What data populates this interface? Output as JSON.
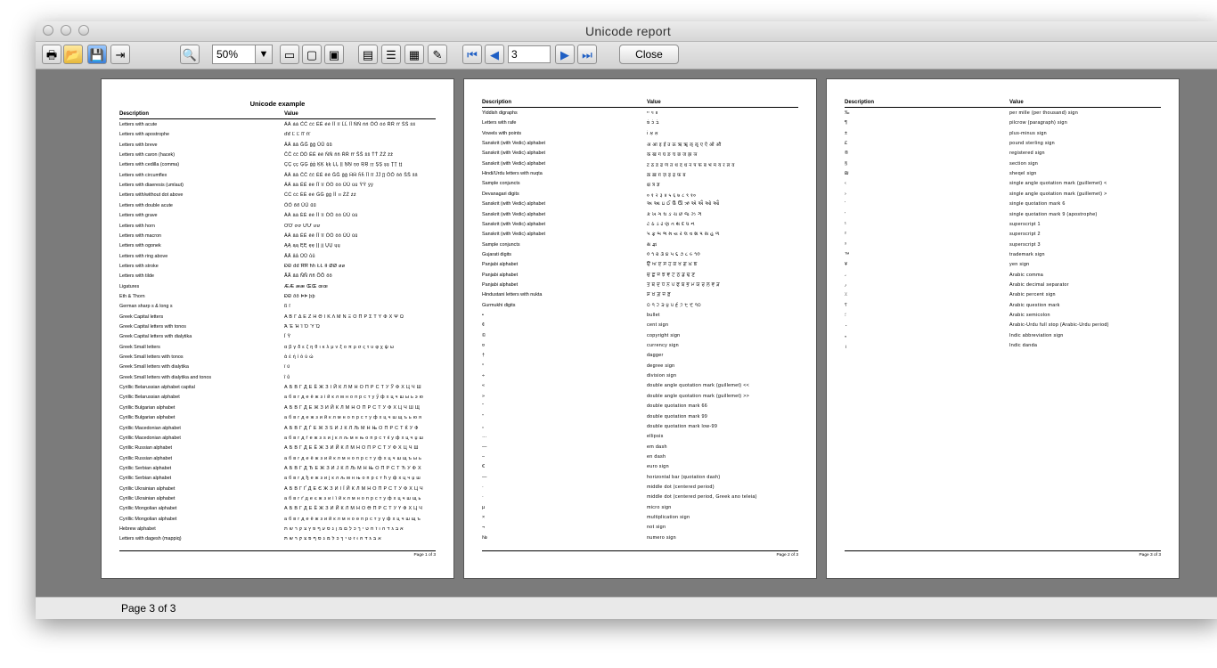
{
  "window": {
    "title": "Unicode report"
  },
  "toolbar": {
    "zoom_value": "50%",
    "page_value": "3",
    "close_label": "Close",
    "icons": [
      "print-icon",
      "open-folder-icon",
      "save-icon",
      "export-icon",
      "find-icon",
      "fit-page-icon",
      "single-page-icon",
      "two-page-icon",
      "page-layout-icon",
      "continuous-icon",
      "thumbnail-icon",
      "edit-icon",
      "first-page-icon",
      "previous-page-icon",
      "next-page-icon",
      "last-page-icon"
    ]
  },
  "status": {
    "text": "Page 3 of 3"
  },
  "pages": [
    {
      "title": "Unicode example",
      "col_desc": "Description",
      "col_value": "Value",
      "footer": "Page 1 of 3",
      "rows": [
        {
          "d": "Letters with acute",
          "v": "ÁÁ áá ĆĆ ćć ÉÉ éé ÍÍ íí ĹĹ ĺĺ ŃŃ ńń ÓÓ óó ŔŔ ŕŕ ŚŚ śś"
        },
        {
          "d": "Letters with apostrophe",
          "v": "ďď Ľ Ľ ľľ ťť"
        },
        {
          "d": "Letters with breve",
          "v": "ĂĂ ăă ĞĞ ğğ ŬŬ ŭŭ"
        },
        {
          "d": "Letters with caron (hacek)",
          "v": "ČČ čč ĎĎ ĚĚ ěě ŇŇ ňň ŘŘ řř ŠŠ šš ŤŤ ŽŽ žž"
        },
        {
          "d": "Letters with cedilla (comma)",
          "v": "ÇÇ çç ĢĢ ģģ ĶĶ ķķ ĻĻ ļļ ŅŅ ņņ ŖŖ ŗŗ ŞŞ şş ŢŢ ţţ"
        },
        {
          "d": "Letters with circumflex",
          "v": "ÂÂ ââ ĈĈ ĉĉ ÊÊ êê ĜĜ ĝĝ ĤĤ ĥĥ ÎÎ îî ĴĴ ĵĵ ÔÔ ôô ŜŜ ŝŝ"
        },
        {
          "d": "Letters with diaeresis (umlaut)",
          "v": "ÄÄ ää ËË ëë ÏÏ ïï ÖÖ öö ÜÜ üü ŸŸ ÿÿ"
        },
        {
          "d": "Letters with/without dot above",
          "v": "ĊĊ ċċ ĖĖ ėė ĠĠ ġġ İİ ıı ŻŻ żż"
        },
        {
          "d": "Letters with double acute",
          "v": "ŐŐ őő ŰŰ űű"
        },
        {
          "d": "Letters with grave",
          "v": "ÀÀ àà ÈÈ èè ÌÌ ìì ÒÒ òò ÙÙ ùù"
        },
        {
          "d": "Letters with horn",
          "v": "ƠƠ ơơ ƯƯ ưư"
        },
        {
          "d": "Letters with macron",
          "v": "ĀĀ āā ĒĒ ēē ĪĪ īī ŌŌ ōō ŪŪ ūū"
        },
        {
          "d": "Letters with ogonek",
          "v": "ĄĄ ąą ĘĘ ęę ĮĮ įį ŲŲ ųų"
        },
        {
          "d": "Letters with ring above",
          "v": "ÅÅ åå ŮŮ ůů"
        },
        {
          "d": "Letters with stroke",
          "v": "ĐĐ đđ ĦĦ ħħ ŁŁ łł ØØ øø"
        },
        {
          "d": "Letters with tilde",
          "v": "ÃÃ ãã ÑÑ ññ ÕÕ õõ"
        },
        {
          "d": "Ligatures",
          "v": "ÆÆ ææ ŒŒ œœ"
        },
        {
          "d": "Eth & Thorn",
          "v": "ÐÐ ðð ÞÞ þþ"
        },
        {
          "d": "German sharp s & long s",
          "v": "ß ſ"
        },
        {
          "d": "Greek Capital letters",
          "v": "Α Β Γ Δ Ε Ζ Η Θ Ι Κ Λ Μ Ν Ξ Ο Π Ρ Σ Τ Υ Φ Χ Ψ Ω"
        },
        {
          "d": "Greek Capital letters with tonos",
          "v": "Ά Έ Ή Ί Ό Ύ Ώ"
        },
        {
          "d": "Greek Capital letters with dialytika",
          "v": "Ϊ Ϋ"
        },
        {
          "d": "Greek Small letters",
          "v": "α β γ δ ε ζ η θ ι κ λ μ ν ξ ο π ρ σ ς τ υ φ χ ψ ω"
        },
        {
          "d": "Greek Small letters with tonos",
          "v": "ά έ ή ί ό ύ ώ"
        },
        {
          "d": "Greek Small letters with dialytika",
          "v": "ϊ ϋ"
        },
        {
          "d": "Greek Small letters with dialytika and tonos",
          "v": "ΐ ΰ"
        },
        {
          "d": "Cyrillic Belarussian alphabet capital",
          "v": "А Б В Г Д Е Ё Ж З І Й К Л М Н О П Р С Т У Ў Ф Х Ц Ч Ш"
        },
        {
          "d": "Cyrillic Belarussian alphabet",
          "v": "а б в г д е ё ж з і й к л м н о п р с т у ў ф х ц ч ш ы ь э ю"
        },
        {
          "d": "Cyrillic Bulgarian alphabet",
          "v": "А Б В Г Д Е Ж З И Й К Л М Н О П Р С Т У Ф Х Ц Ч Ш Щ"
        },
        {
          "d": "Cyrillic Bulgarian alphabet",
          "v": "а б в г д е ж з и й к л м н о п р с т у ф х ц ч ш щ ъ ь ю я"
        },
        {
          "d": "Cyrillic Macedonian alphabet",
          "v": "А Б В Г Д Ѓ Е Ж З Ѕ И Ј К Л Љ М Н Њ О П Р С Т Ќ У Ф"
        },
        {
          "d": "Cyrillic Macedonian alphabet",
          "v": "а б в г д ѓ е ж з ѕ и ј к л љ м н њ о п р с т ќ у ф х ц ч џ ш"
        },
        {
          "d": "Cyrillic Russian alphabet",
          "v": "А Б В Г Д Е Ё Ж З И Й К Л М Н О П Р С Т У Ф Х Ц Ч Ш"
        },
        {
          "d": "Cyrillic Russian alphabet",
          "v": "а б в г д е ё ж з и й к л м н о п р с т у ф х ц ч ш щ ъ ы ь"
        },
        {
          "d": "Cyrillic Serbian alphabet",
          "v": "А Б В Г Д Ђ Е Ж З И Ј К Л Љ М Н Њ О П Р С Т Ћ У Ф Х"
        },
        {
          "d": "Cyrillic Serbian alphabet",
          "v": "а б в г д ђ е ж з и ј к л љ м н њ о п р с т ћ у ф х ц ч џ ш"
        },
        {
          "d": "Cyrillic Ukrainian alphabet",
          "v": "А Б В Г Ґ Д Е Є Ж З И І Ї Й К Л М Н О П Р С Т У Ф Х Ц Ч"
        },
        {
          "d": "Cyrillic Ukrainian alphabet",
          "v": "а б в г ґ д е є ж з и і ї й к л м н о п р с т у ф х ц ч ш щ ь"
        },
        {
          "d": "Cyrillic Mongolian alphabet",
          "v": "А Б В Г Д Е Ё Ж З И Й К Л М Н О Ө П Р С Т У Ү Ф Х Ц Ч"
        },
        {
          "d": "Cyrillic Mongolian alphabet",
          "v": "а б в г д е ё ж з и й к л м н о ө п р с т у ү ф х ц ч ш щ ъ"
        },
        {
          "d": "Hebrew alphabet",
          "v": "א ב ג ד ה ו ז ח ט י ך כ ל ם מ ן נ ס ע ף פ ץ צ ק ר ש ת"
        },
        {
          "d": "Letters with dagesh (mappiq)",
          "v": "אּ בּ גּ דּ הּ וּ זּ טּ יּ ךּ כּ לּ מּ נּ סּ ףּ פּ צּ קּ רּ שּ תּ"
        }
      ]
    },
    {
      "col_desc": "Description",
      "col_value": "Value",
      "footer": "Page 2 of 3",
      "rows": [
        {
          "d": "Yiddish digraphs",
          "v": "װ ױ ײ"
        },
        {
          "d": "Letters with rafe",
          "v": "בֿ כֿ פֿ"
        },
        {
          "d": "Vowels with points",
          "v": "אַ אָ וֹ"
        },
        {
          "d": "Sanskrit (with Vedic) alphabet",
          "v": "अ आ इ ई उ ऊ ऋ ॠ ऌ ॡ ए ऐ ओ औ"
        },
        {
          "d": "Sanskrit (with Vedic) alphabet",
          "v": "क ख ग घ ङ च छ ज झ ञ"
        },
        {
          "d": "Sanskrit (with Vedic) alphabet",
          "v": "ट ठ ड ढ ण त थ द ध न प फ ब भ म य र ल व"
        },
        {
          "d": "Hindi/Urdu letters with nuqta",
          "v": "क़ ख़ ग़ ज़ ड़ ढ़ फ़ य़"
        },
        {
          "d": "Sample conjuncts",
          "v": "क्ष त्र ज्ञ"
        },
        {
          "d": "Devanagari digits",
          "v": "० १ २ ३ ४ ५ ६ ७ ८ ९ १०"
        },
        {
          "d": "Sanskrit (with Vedic) alphabet",
          "v": "અ આ ઇ ઈ ઉ ઊ ઋ એ ઐ ઓ ઔ"
        },
        {
          "d": "Sanskrit (with Vedic) alphabet",
          "v": "ક ખ ગ ઘ ઙ ચ છ જ ઝ ઞ"
        },
        {
          "d": "Sanskrit (with Vedic) alphabet",
          "v": "ટ ઠ ડ ઢ ણ ત થ દ ધ ન"
        },
        {
          "d": "Sanskrit (with Vedic) alphabet",
          "v": "પ ફ બ ભ મ ય ર લ વ શ ષ સ હ ળ"
        },
        {
          "d": "Sample conjuncts",
          "v": "ક્ષ જ્ઞ"
        },
        {
          "d": "Gujarati digits",
          "v": "૦ ૧ ૨ ૩ ૪ ૫ ૬ ૭ ૮ ૯ ૧૦"
        },
        {
          "d": "Panjabi alphabet",
          "v": "ੳ ਅ ੲ ਸ ਹ ਕ ਖ ਗ ਘ ਙ"
        },
        {
          "d": "Panjabi alphabet",
          "v": "ਚ ਛ ਜ ਝ ਞ ਟ ਠ ਡ ਢ ਣ"
        },
        {
          "d": "Panjabi alphabet",
          "v": "ਤ ਥ ਦ ਧ ਨ ਪ ਫ ਬ ਭ ਮ ਯ ਰ ਲ ਵ ੜ"
        },
        {
          "d": "Hindustani letters with nukta",
          "v": "ਸ਼ ਖ਼ ਗ਼ ਜ਼ ਫ਼"
        },
        {
          "d": "Gurmukhi digits",
          "v": "੦ ੧ ੨ ੩ ੪ ੫ ੬ ੭ ੮ ੯ ੧੦"
        },
        {
          "d": "•",
          "v": "bullet"
        },
        {
          "d": "¢",
          "v": "cent sign"
        },
        {
          "d": "©",
          "v": "copyright sign"
        },
        {
          "d": "¤",
          "v": "currency sign"
        },
        {
          "d": "†",
          "v": "dagger"
        },
        {
          "d": "°",
          "v": "degree sign"
        },
        {
          "d": "÷",
          "v": "division sign"
        },
        {
          "d": "«",
          "v": "double angle quotation mark (guillemet) <<"
        },
        {
          "d": "»",
          "v": "double angle quotation mark (guillemet) >>"
        },
        {
          "d": "“",
          "v": "double quotation mark 66"
        },
        {
          "d": "”",
          "v": "double quotation mark 99"
        },
        {
          "d": "„",
          "v": "double quotation mark low-99"
        },
        {
          "d": "…",
          "v": "ellipsis"
        },
        {
          "d": "—",
          "v": "em dash"
        },
        {
          "d": "–",
          "v": "en dash"
        },
        {
          "d": "€",
          "v": "euro sign"
        },
        {
          "d": "―",
          "v": "horizontal bar (quotation dash)"
        },
        {
          "d": "·",
          "v": "middle dot (centered period)"
        },
        {
          "d": "·",
          "v": "middle dot (centered period, Greek ano teleia)"
        },
        {
          "d": "µ",
          "v": "micro sign"
        },
        {
          "d": "×",
          "v": "multiplication sign"
        },
        {
          "d": "¬",
          "v": "not sign"
        },
        {
          "d": "№",
          "v": "numero sign"
        }
      ]
    },
    {
      "col_desc": "Description",
      "col_value": "Value",
      "footer": "Page 3 of 3",
      "rows": [
        {
          "d": "‰",
          "v": "per mille (per thousand) sign"
        },
        {
          "d": "¶",
          "v": "pilcrow (paragraph) sign"
        },
        {
          "d": "±",
          "v": "plus-minus sign"
        },
        {
          "d": "£",
          "v": "pound sterling sign"
        },
        {
          "d": "®",
          "v": "registered sign"
        },
        {
          "d": "§",
          "v": "section sign"
        },
        {
          "d": "₪",
          "v": "sheqel sign"
        },
        {
          "d": "‹",
          "v": "single angle quotation mark (guillemet) <"
        },
        {
          "d": "›",
          "v": "single angle quotation mark (guillemet) >"
        },
        {
          "d": "‘",
          "v": "single quotation mark 6"
        },
        {
          "d": "’",
          "v": "single quotation mark 9 (apostrophe)"
        },
        {
          "d": "¹",
          "v": "superscript 1"
        },
        {
          "d": "²",
          "v": "superscript 2"
        },
        {
          "d": "³",
          "v": "superscript 3"
        },
        {
          "d": "™",
          "v": "trademark sign"
        },
        {
          "d": "¥",
          "v": "yen sign"
        },
        {
          "d": "،",
          "v": "Arabic comma"
        },
        {
          "d": "٫",
          "v": "Arabic decimal separator"
        },
        {
          "d": "٪",
          "v": "Arabic percent sign"
        },
        {
          "d": "؟",
          "v": "Arabic question mark"
        },
        {
          "d": "؛",
          "v": "Arabic semicolon"
        },
        {
          "d": "۔",
          "v": "Arabic-Urdu full stop (Arabic-Urdu period)"
        },
        {
          "d": "॰",
          "v": "Indic abbreviation sign"
        },
        {
          "d": "।",
          "v": "Indic danda"
        }
      ]
    }
  ]
}
